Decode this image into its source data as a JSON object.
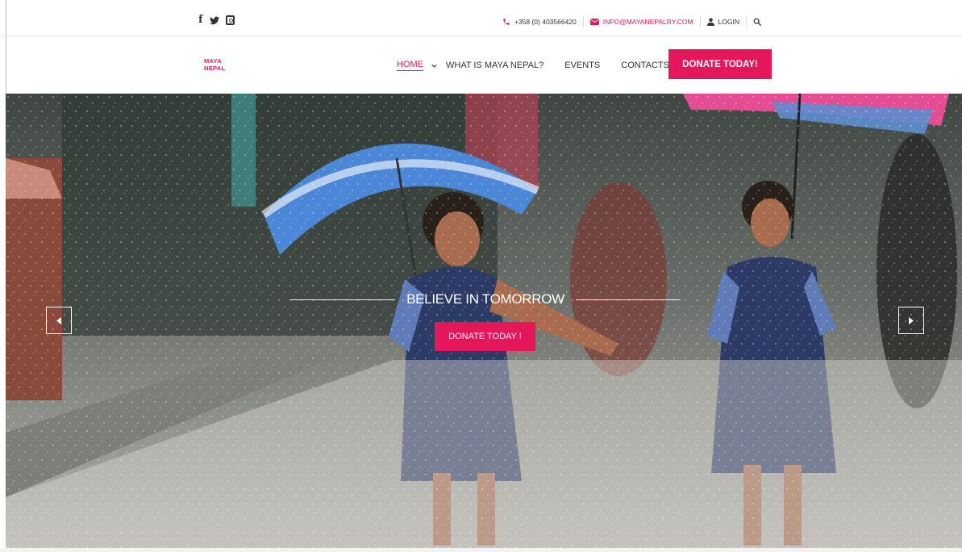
{
  "topbar": {
    "social_icons": [
      "facebook-icon",
      "twitter-icon",
      "instagram-icon"
    ],
    "phone": "+358 (0) 403566420",
    "email": "INFO@MAYANEPALRY.COM",
    "login": "LOGIN",
    "search_icon": "search-icon"
  },
  "brand": {
    "line1": "MAYA",
    "line2": "NEPAL",
    "color": "#e4175a"
  },
  "nav": {
    "items": [
      {
        "label": "HOME"
      },
      {
        "label": "WHAT IS MAYA NEPAL?"
      },
      {
        "label": "EVENTS"
      },
      {
        "label": "CONTACTS"
      }
    ],
    "cta": "DONATE TODAY!"
  },
  "hero": {
    "title": "BELIEVE IN TOMORROW",
    "cta": "DONATE TODAY !",
    "prev_icon": "caret-left-icon",
    "next_icon": "caret-right-icon"
  },
  "colors": {
    "accent": "#e4175a",
    "text": "#333333"
  }
}
